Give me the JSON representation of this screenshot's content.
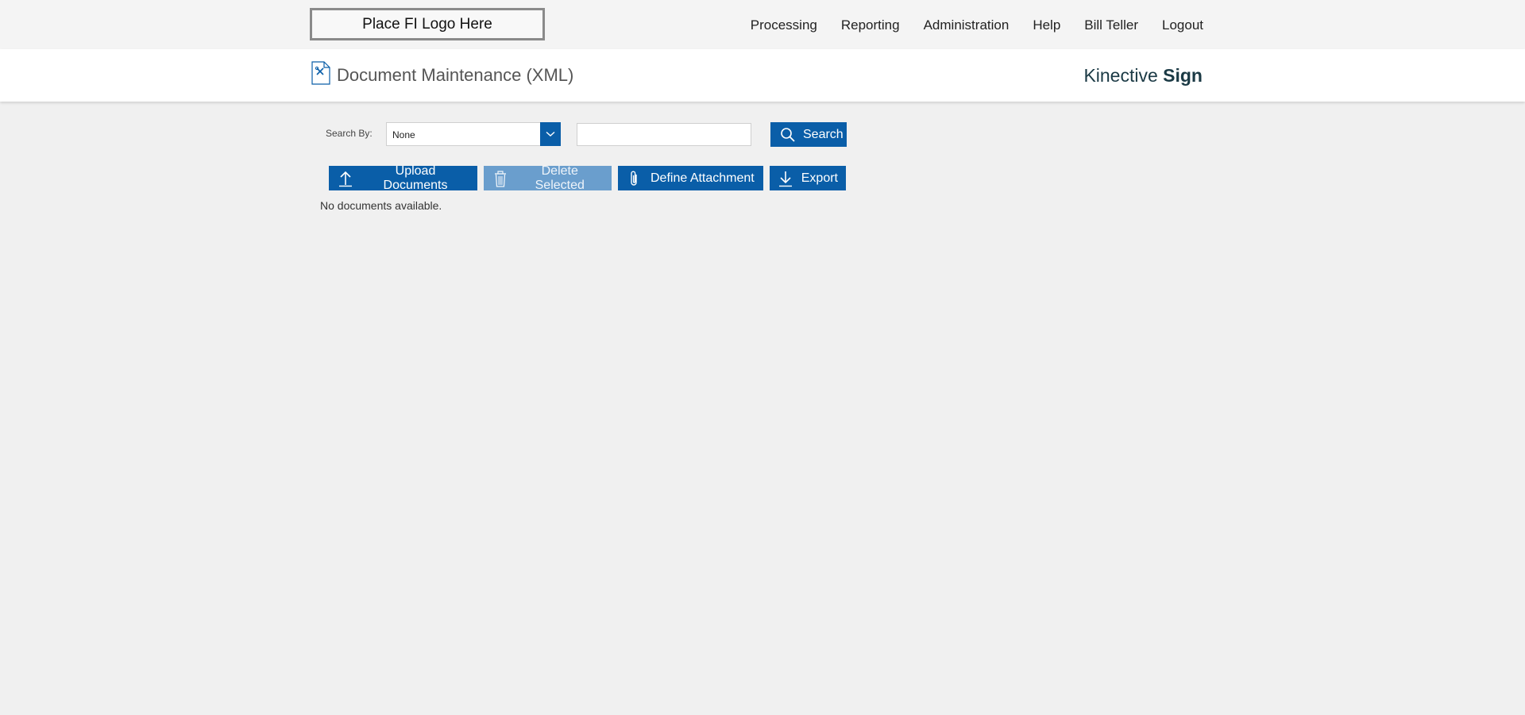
{
  "topbar": {
    "logo_text": "Place FI Logo Here",
    "nav": [
      "Processing",
      "Reporting",
      "Administration",
      "Help",
      "Bill Teller",
      "Logout"
    ]
  },
  "header": {
    "icon": "document-tools-icon",
    "title": "Document Maintenance (XML)",
    "brand_regular": "Kinective ",
    "brand_bold": "Sign"
  },
  "search": {
    "label": "Search By:",
    "selected_option": "None",
    "input_value": "",
    "input_placeholder": "",
    "button_label": "Search"
  },
  "toolbar": {
    "upload_label": "Upload Documents",
    "delete_label": "Delete Selected",
    "define_label": "Define Attachment",
    "export_label": "Export"
  },
  "content": {
    "empty_message": "No documents available."
  },
  "colors": {
    "primary": "#0a5ea8",
    "disabled": "#6a9ecd",
    "brand_text": "#1b3a45",
    "background": "#f0f0f0"
  }
}
